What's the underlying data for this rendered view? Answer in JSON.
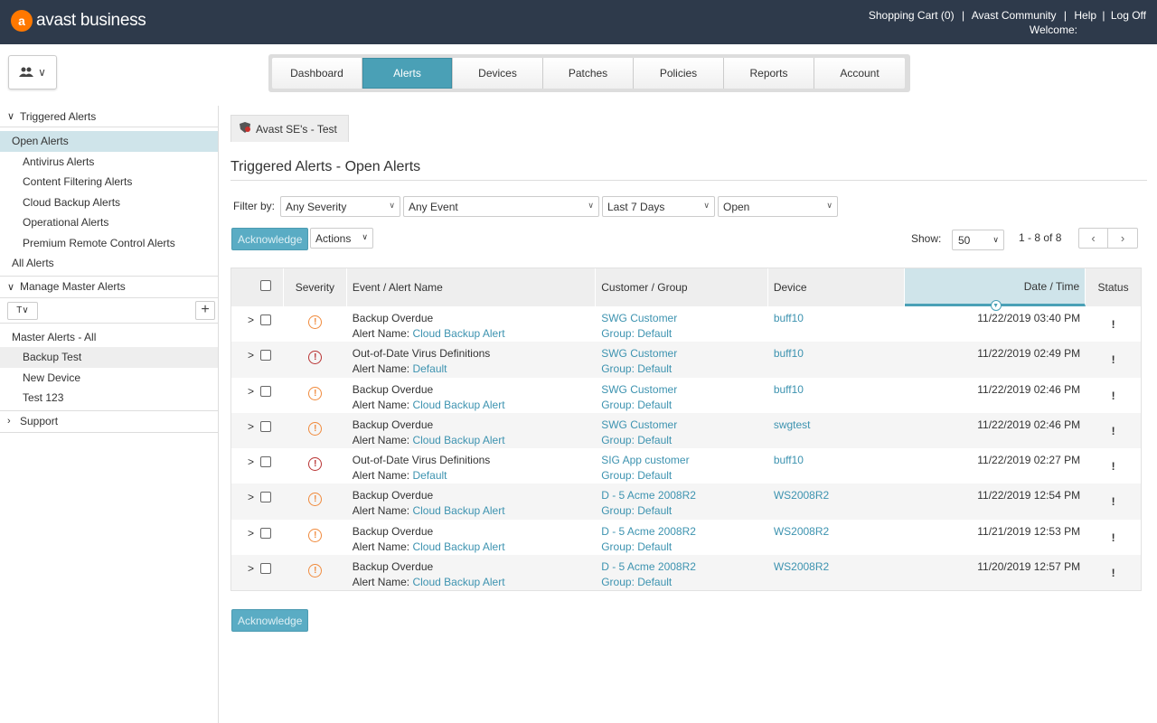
{
  "brand": {
    "mark": "a",
    "name": "avast business"
  },
  "toplinks": {
    "cart": "Shopping Cart (0)",
    "sep": "|",
    "community": "Avast Community",
    "help": "Help",
    "logoff": "Log Off",
    "welcome": "Welcome:"
  },
  "user_menu": {
    "icon": "users-icon",
    "caret": "∨"
  },
  "nav": [
    "Dashboard",
    "Alerts",
    "Devices",
    "Patches",
    "Policies",
    "Reports",
    "Account"
  ],
  "nav_active": "Alerts",
  "sidebar": {
    "triggered": {
      "title": "Triggered Alerts",
      "items": [
        "Open Alerts",
        "Antivirus Alerts",
        "Content Filtering Alerts",
        "Cloud Backup Alerts",
        "Operational Alerts",
        "Premium Remote Control Alerts",
        "All Alerts"
      ]
    },
    "master": {
      "title": "Manage Master Alerts",
      "filter": "T∨",
      "add": "+",
      "items": [
        "Master Alerts - All",
        "Backup Test",
        "New Device",
        "Test 123"
      ]
    },
    "support": {
      "title": "Support"
    }
  },
  "main": {
    "customer_tab": "Avast SE's - Test",
    "title": "Triggered Alerts - Open Alerts",
    "filter_label": "Filter by:",
    "filters": {
      "severity": "Any Severity",
      "event": "Any Event",
      "period": "Last 7 Days",
      "state": "Open"
    },
    "acknowledge": "Acknowledge",
    "actions": "Actions",
    "show_label": "Show:",
    "show_value": "50",
    "range": "1 - 8 of 8",
    "prev": "‹",
    "next": "›"
  },
  "columns": [
    "Severity",
    "Event / Alert Name",
    "Customer / Group",
    "Device",
    "Date / Time",
    "Status"
  ],
  "alert_name_label": "Alert Name: ",
  "rows": [
    {
      "event": "Backup Overdue",
      "alert": "Cloud Backup Alert",
      "customer": "SWG Customer",
      "group": "Group: Default",
      "device": "buff10",
      "time": "11/22/2019 03:40 PM",
      "status": "!",
      "severity": "medium"
    },
    {
      "event": "Out-of-Date Virus Definitions",
      "alert": "Default",
      "customer": "SWG Customer",
      "group": "Group: Default",
      "device": "buff10",
      "time": "11/22/2019 02:49 PM",
      "status": "!",
      "severity": "high"
    },
    {
      "event": "Backup Overdue",
      "alert": "Cloud Backup Alert",
      "customer": "SWG Customer",
      "group": "Group: Default",
      "device": "buff10",
      "time": "11/22/2019 02:46 PM",
      "status": "!",
      "severity": "medium"
    },
    {
      "event": "Backup Overdue",
      "alert": "Cloud Backup Alert",
      "customer": "SWG Customer",
      "group": "Group: Default",
      "device": "swgtest",
      "time": "11/22/2019 02:46 PM",
      "status": "!",
      "severity": "medium"
    },
    {
      "event": "Out-of-Date Virus Definitions",
      "alert": "Default",
      "customer": "SIG App customer",
      "group": "Group: Default",
      "device": "buff10",
      "time": "11/22/2019 02:27 PM",
      "status": "!",
      "severity": "high"
    },
    {
      "event": "Backup Overdue",
      "alert": "Cloud Backup Alert",
      "customer": "D - 5 Acme 2008R2",
      "group": "Group: Default",
      "device": "WS2008R2",
      "time": "11/22/2019 12:54 PM",
      "status": "!",
      "severity": "medium"
    },
    {
      "event": "Backup Overdue",
      "alert": "Cloud Backup Alert",
      "customer": "D - 5 Acme 2008R2",
      "group": "Group: Default",
      "device": "WS2008R2",
      "time": "11/21/2019 12:53 PM",
      "status": "!",
      "severity": "medium"
    },
    {
      "event": "Backup Overdue",
      "alert": "Cloud Backup Alert",
      "customer": "D - 5 Acme 2008R2",
      "group": "Group: Default",
      "device": "WS2008R2",
      "time": "11/20/2019 12:57 PM",
      "status": "!",
      "severity": "medium"
    }
  ],
  "colors": {
    "topbar": "#2e3a4b",
    "accent": "#4aa0b6",
    "link": "#3d93b0",
    "sev_medium": "#f08a3c",
    "sev_high": "#b83232",
    "brand": "#ff7800"
  }
}
